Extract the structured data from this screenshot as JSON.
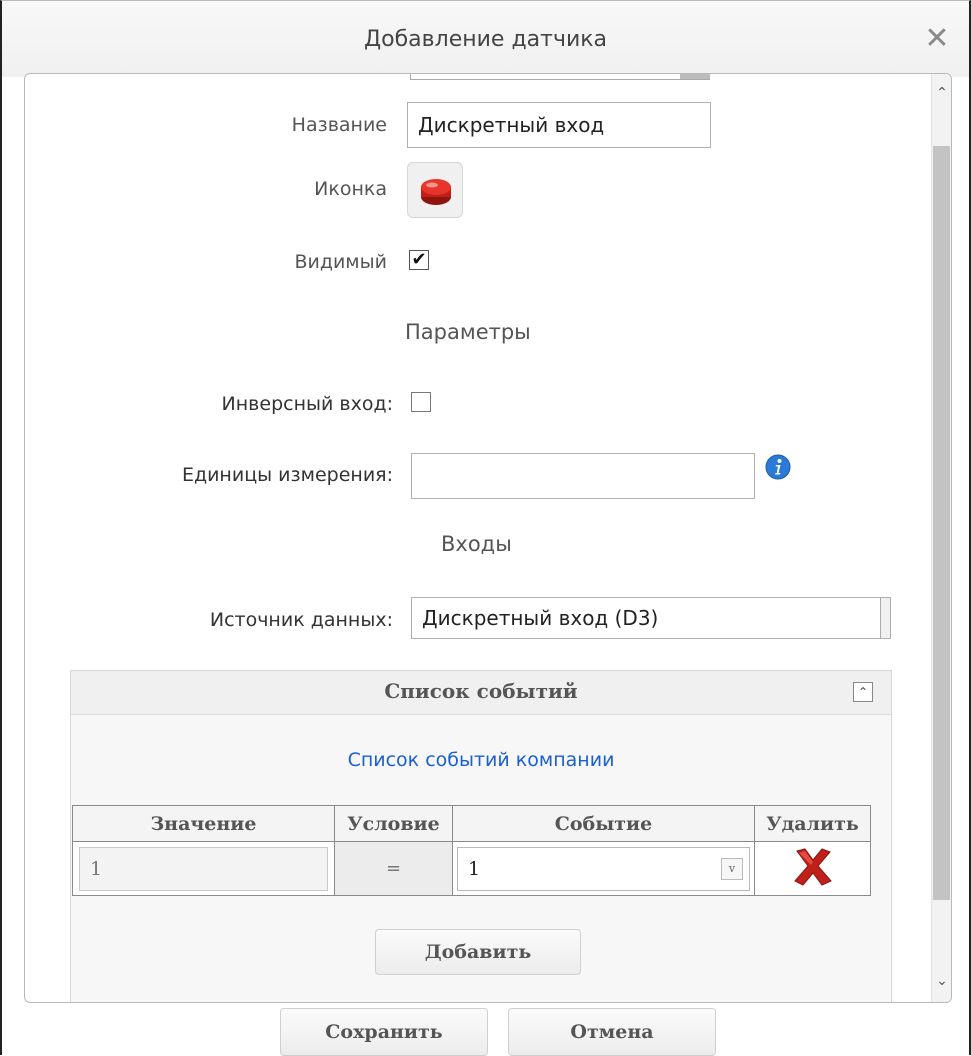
{
  "dialog": {
    "title": "Добавление датчика",
    "close_icon": "close-icon"
  },
  "form": {
    "name_label": "Название",
    "name_value": "Дискретный вход",
    "icon_label": "Иконка",
    "icon_name": "red-button-icon",
    "visible_label": "Видимый",
    "visible_checked": true,
    "params_title": "Параметры",
    "inverse_label": "Инверсный вход:",
    "inverse_checked": false,
    "units_label": "Единицы измерения:",
    "units_value": "",
    "info_icon": "info-icon",
    "inputs_title": "Входы",
    "source_label": "Источник данных:",
    "source_value": "Дискретный вход (D3)"
  },
  "events": {
    "title": "Список событий",
    "collapse_icon": "collapse-up-icon",
    "company_link": "Список событий компании",
    "columns": [
      "Значение",
      "Условие",
      "Событие",
      "Удалить"
    ],
    "rows": [
      {
        "value": "1",
        "condition": "=",
        "event": "1",
        "delete_icon": "delete-x-icon"
      }
    ],
    "add_label": "Добавить"
  },
  "footer": {
    "save_label": "Сохранить",
    "cancel_label": "Отмена"
  },
  "colors": {
    "link": "#1a5fd4",
    "delete": "#c0201a",
    "icon_red": "#d9231c"
  }
}
